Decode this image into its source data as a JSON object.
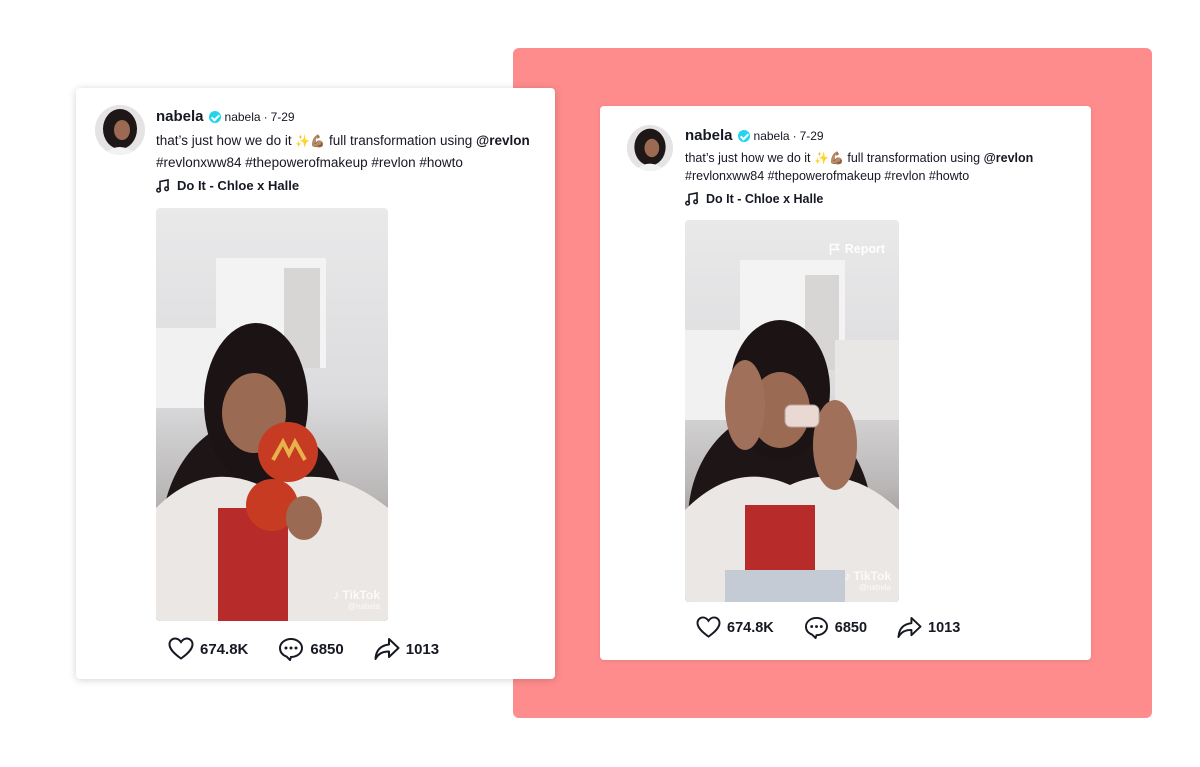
{
  "posts": [
    {
      "username": "nabela",
      "handle": "nabela",
      "separator": "·",
      "date": "7-29",
      "caption": {
        "line1_text": "that’s just how we do it ",
        "emoji": "✨💪🏽",
        "line1_after": " full transformation using ",
        "mention": "@revlon",
        "line2": "#revlonxww84 #thepowerofmakeup #revlon #howto"
      },
      "music": "Do It - Chloe x Halle",
      "video": {
        "watermark_logo": "TikTok",
        "watermark_handle": "@nabela"
      },
      "stats": {
        "likes": "674.8K",
        "comments": "6850",
        "shares": "1013"
      }
    },
    {
      "username": "nabela",
      "handle": "nabela",
      "separator": "·",
      "date": "7-29",
      "caption": {
        "line1_text": "that’s just how we do it ",
        "emoji": "✨💪🏽",
        "line1_after": " full transformation using ",
        "mention": "@revlon",
        "line2": "#revlonxww84 #thepowerofmakeup #revlon #howto"
      },
      "music": "Do It - Chloe x Halle",
      "video": {
        "report_label": "Report",
        "watermark_logo": "TikTok",
        "watermark_handle": "@nabela"
      },
      "stats": {
        "likes": "674.8K",
        "comments": "6850",
        "shares": "1013"
      }
    }
  ],
  "colors": {
    "background_panel": "#ff8c8c",
    "verified_badge": "#20d5ec",
    "text": "#161823"
  },
  "icons": [
    "verified-badge-icon",
    "music-note-icon",
    "heart-icon",
    "comment-icon",
    "share-icon",
    "flag-icon",
    "tiktok-logo-icon"
  ]
}
